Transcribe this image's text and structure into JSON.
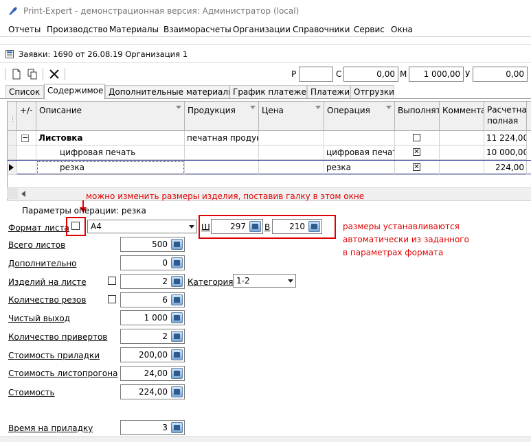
{
  "window": {
    "title": "Print-Expert - демонстрационная версия: Администратор (local)"
  },
  "menu": [
    "Отчеты",
    "Производство",
    "Материалы",
    "Взаиморасчеты",
    "Организации",
    "Справочники",
    "Сервис",
    "Окна"
  ],
  "document": {
    "caption": "Заявки: 1690 от 26.08.19  Организация 1"
  },
  "toolbar": {
    "icons": [
      "new-document-icon",
      "copy-icon",
      "delete-icon"
    ],
    "totals": [
      {
        "label": "Р",
        "value": ""
      },
      {
        "label": "С",
        "value": "0,00"
      },
      {
        "label": "М",
        "value": "1 000,00"
      },
      {
        "label": "У",
        "value": "0,00"
      }
    ]
  },
  "tabs": [
    {
      "label": "Список",
      "active": false
    },
    {
      "label": "Содержимое",
      "active": true
    },
    {
      "label": "Дополнительные материалы",
      "active": false
    },
    {
      "label": "График платежей",
      "active": false
    },
    {
      "label": "Платежи",
      "active": false
    },
    {
      "label": "Отгрузки",
      "active": false
    }
  ],
  "grid": {
    "columns": [
      "+/-",
      "Описание",
      "Продукция",
      "Цена",
      "Операция",
      "Выполнят",
      "Коммента",
      "Расчетна\nполная"
    ],
    "rows": [
      {
        "toggle": "−",
        "description": "Листовка",
        "product": "печатная продукц",
        "price": "",
        "operation": "",
        "done": false,
        "comment": "",
        "total": "11 224,00",
        "bold": true,
        "indent": false
      },
      {
        "toggle": "",
        "description": "цифровая печать",
        "product": "",
        "price": "",
        "operation": "цифровая печать",
        "done": true,
        "comment": "",
        "total": "10 000,00",
        "bold": false,
        "indent": true
      },
      {
        "toggle": "",
        "description": "резка",
        "product": "",
        "price": "",
        "operation": "резка",
        "done": true,
        "comment": "",
        "total": "224,00",
        "bold": false,
        "indent": true,
        "current": true
      }
    ]
  },
  "annotations": {
    "top": "можно изменить размеры изделия, поставив галку в этом окне",
    "right_1": "размеры устанавливаются",
    "right_2": "автоматически из заданного",
    "right_3": "в параметрах формата"
  },
  "params": {
    "title": "Параметры операции: резка",
    "format_label": "Формат листа",
    "format_value": "A4",
    "width_label": "Ш",
    "width_value": "297",
    "height_label": "В",
    "height_value": "210",
    "category_label": "Категория",
    "category_value": "1-2",
    "fields": [
      {
        "label": "Всего листов",
        "value": "500",
        "has_check": false
      },
      {
        "label": "Дополнительно",
        "value": "0",
        "has_check": false
      },
      {
        "label": "Изделий на листе",
        "value": "2",
        "has_check": true
      },
      {
        "label": "Количество резов",
        "value": "6",
        "has_check": true
      },
      {
        "label": "Чистый выход",
        "value": "1 000",
        "has_check": false
      },
      {
        "label": "Количество привертов",
        "value": "2",
        "has_check": false
      },
      {
        "label": "Стоимость приладки",
        "value": "200,00",
        "has_check": false
      },
      {
        "label": "Стоимость листопрогона",
        "value": "24,00",
        "has_check": false
      },
      {
        "label": "Стоимость",
        "value": "224,00",
        "has_check": false
      },
      {
        "label": "Время на приладку",
        "value": "3",
        "has_check": false
      }
    ]
  }
}
